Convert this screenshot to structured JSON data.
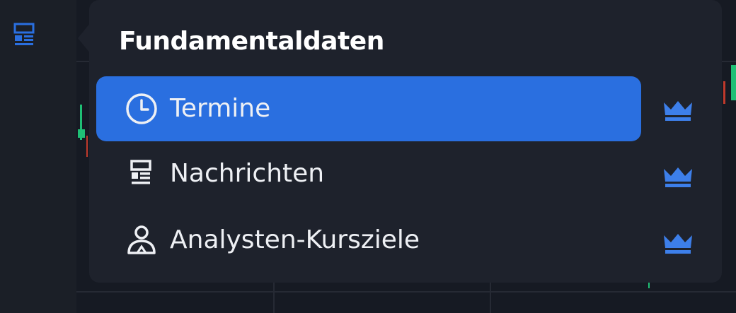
{
  "toolbar": {
    "icons": [
      "news-icon"
    ]
  },
  "popup": {
    "title": "Fundamentaldaten",
    "items": [
      {
        "label": "Termine",
        "icon": "clock-icon",
        "active": true,
        "premium": true
      },
      {
        "label": "Nachrichten",
        "icon": "news-icon",
        "active": false,
        "premium": true
      },
      {
        "label": "Analysten-Kursziele",
        "icon": "analyst-icon",
        "active": false,
        "premium": true
      }
    ]
  },
  "colors": {
    "accent": "#2a6fe0",
    "crown": "#3d7fea",
    "popup_bg": "#1e222c",
    "toolbar_bg": "#1b1f27",
    "candle_up": "#1fbf75",
    "candle_down": "#c0392b"
  }
}
